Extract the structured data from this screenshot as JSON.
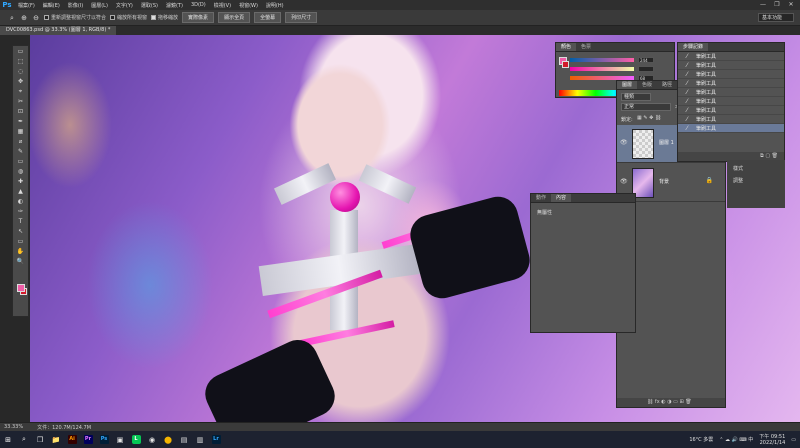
{
  "app": {
    "logo": "Ps",
    "window_controls": [
      "—",
      "❐",
      "✕"
    ]
  },
  "menu": [
    "檔案(F)",
    "編輯(E)",
    "影像(I)",
    "圖層(L)",
    "文字(Y)",
    "選取(S)",
    "濾鏡(T)",
    "3D(D)",
    "檢視(V)",
    "視窗(W)",
    "說明(H)"
  ],
  "options": {
    "chk1": "重新調整視窗尺寸以符合",
    "chk2": "縮放所有視窗",
    "chk3": "拖移縮放",
    "btn_actual": "實際像素",
    "btn_fit": "顯示全頁",
    "btn_fill": "全螢幕",
    "btn_print": "列印尺寸",
    "workspace": "基本功能"
  },
  "doc_tab": "DVC00863.psd @ 33.3% (圖層 1, RGB/8) *",
  "tools": [
    "▭",
    "⬚",
    "◌",
    "✥",
    "⌖",
    "✂",
    "⊡",
    "✒",
    "▦",
    "⌀",
    "✎",
    "▭",
    "◍",
    "✚",
    "▲",
    "◐",
    "✑",
    "T",
    "↖",
    "▭",
    "✋",
    "🔍"
  ],
  "color_panel": {
    "tabs": [
      "顏色",
      "色票"
    ],
    "r": "244",
    "g": "",
    "b": "68",
    "fg": "#f05ea8",
    "bg": "#d11a2a"
  },
  "history_panel": {
    "tabs": [
      "步驟記錄"
    ],
    "items": [
      "筆刷工具",
      "筆刷工具",
      "筆刷工具",
      "筆刷工具",
      "筆刷工具",
      "筆刷工具",
      "筆刷工具",
      "筆刷工具",
      "筆刷工具"
    ]
  },
  "layers_panel": {
    "tabs": [
      "圖層",
      "色版",
      "路徑"
    ],
    "kind": "種類",
    "blend_mode": "正常",
    "opacity_label": "不透",
    "lock_label": "鎖定:",
    "layers": [
      {
        "name": "圖層 1",
        "selected": true
      },
      {
        "name": "背景",
        "selected": false
      }
    ]
  },
  "props_panel": {
    "tabs": [
      "動作",
      "內容"
    ],
    "body": "無屬性"
  },
  "side_dock": {
    "items": [
      "樣式",
      "調整"
    ]
  },
  "status": {
    "zoom": "33.33%",
    "doc_size": "文件：120.7M/124.7M"
  },
  "taskbar": {
    "apps": [
      "⊞",
      "⌕",
      "❒",
      "📁",
      "Ai",
      "Pr",
      "Ps",
      "▣",
      "L",
      "◉",
      "⬤",
      "▤",
      "▥",
      "Lr"
    ],
    "weather": "16°C 多雲",
    "time": "下午 09:51",
    "date": "2022/1/14"
  }
}
